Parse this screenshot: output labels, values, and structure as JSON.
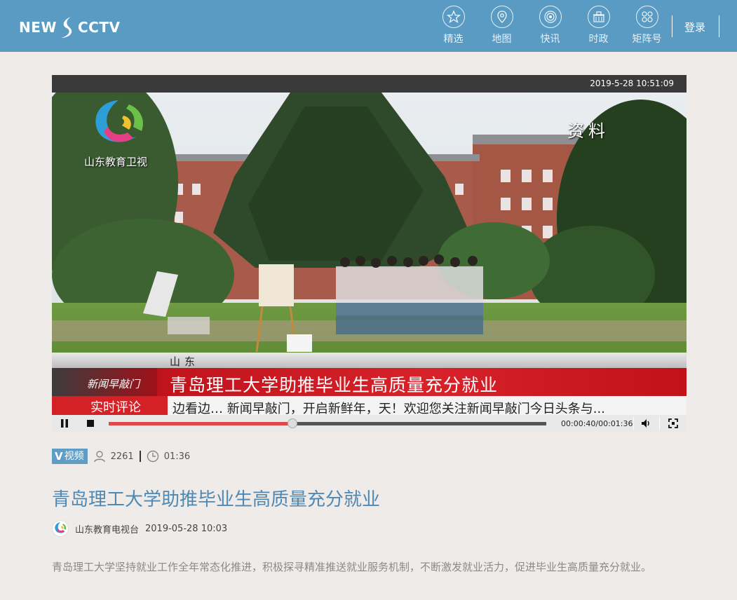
{
  "header": {
    "logo_left": "NEW",
    "logo_right": "CCTV",
    "nav": [
      {
        "label": "精选",
        "icon": "star-icon"
      },
      {
        "label": "地图",
        "icon": "map-pin-icon"
      },
      {
        "label": "快讯",
        "icon": "broadcast-icon"
      },
      {
        "label": "时政",
        "icon": "building-icon"
      },
      {
        "label": "矩阵号",
        "icon": "matrix-icon"
      }
    ],
    "login_label": "登录"
  },
  "video": {
    "timestamp": "2019-5-28 10:51:09",
    "overlay_label": "资料",
    "station_name": "山东教育卫视",
    "lower_third": {
      "region": "山东",
      "show_name": "新闻早敲门",
      "headline": "青岛理工大学助推毕业生高质量充分就业"
    },
    "ticker": {
      "tag": "实时评论",
      "text": "边看边…   新闻早敲门，开启新鲜年，天！欢迎您关注新闻早敲门今日头条与..."
    },
    "controls": {
      "time_display": "00:00:40/00:01:36",
      "progress": 0.42
    }
  },
  "meta": {
    "badge_v": "V",
    "badge_label": "视频",
    "views": "2261",
    "duration": "01:36"
  },
  "article": {
    "title": "青岛理工大学助推毕业生高质量充分就业",
    "source": "山东教育电视台",
    "date": "2019-05-28 10:03",
    "summary": "青岛理工大学坚持就业工作全年常态化推进，积极探寻精准推送就业服务机制，不断激发就业活力，促进毕业生高质量充分就业。"
  },
  "colors": {
    "header_bg": "#5a9bc4",
    "title": "#4e88b4",
    "progress": "#e0474a",
    "page_bg": "#efebe8"
  }
}
